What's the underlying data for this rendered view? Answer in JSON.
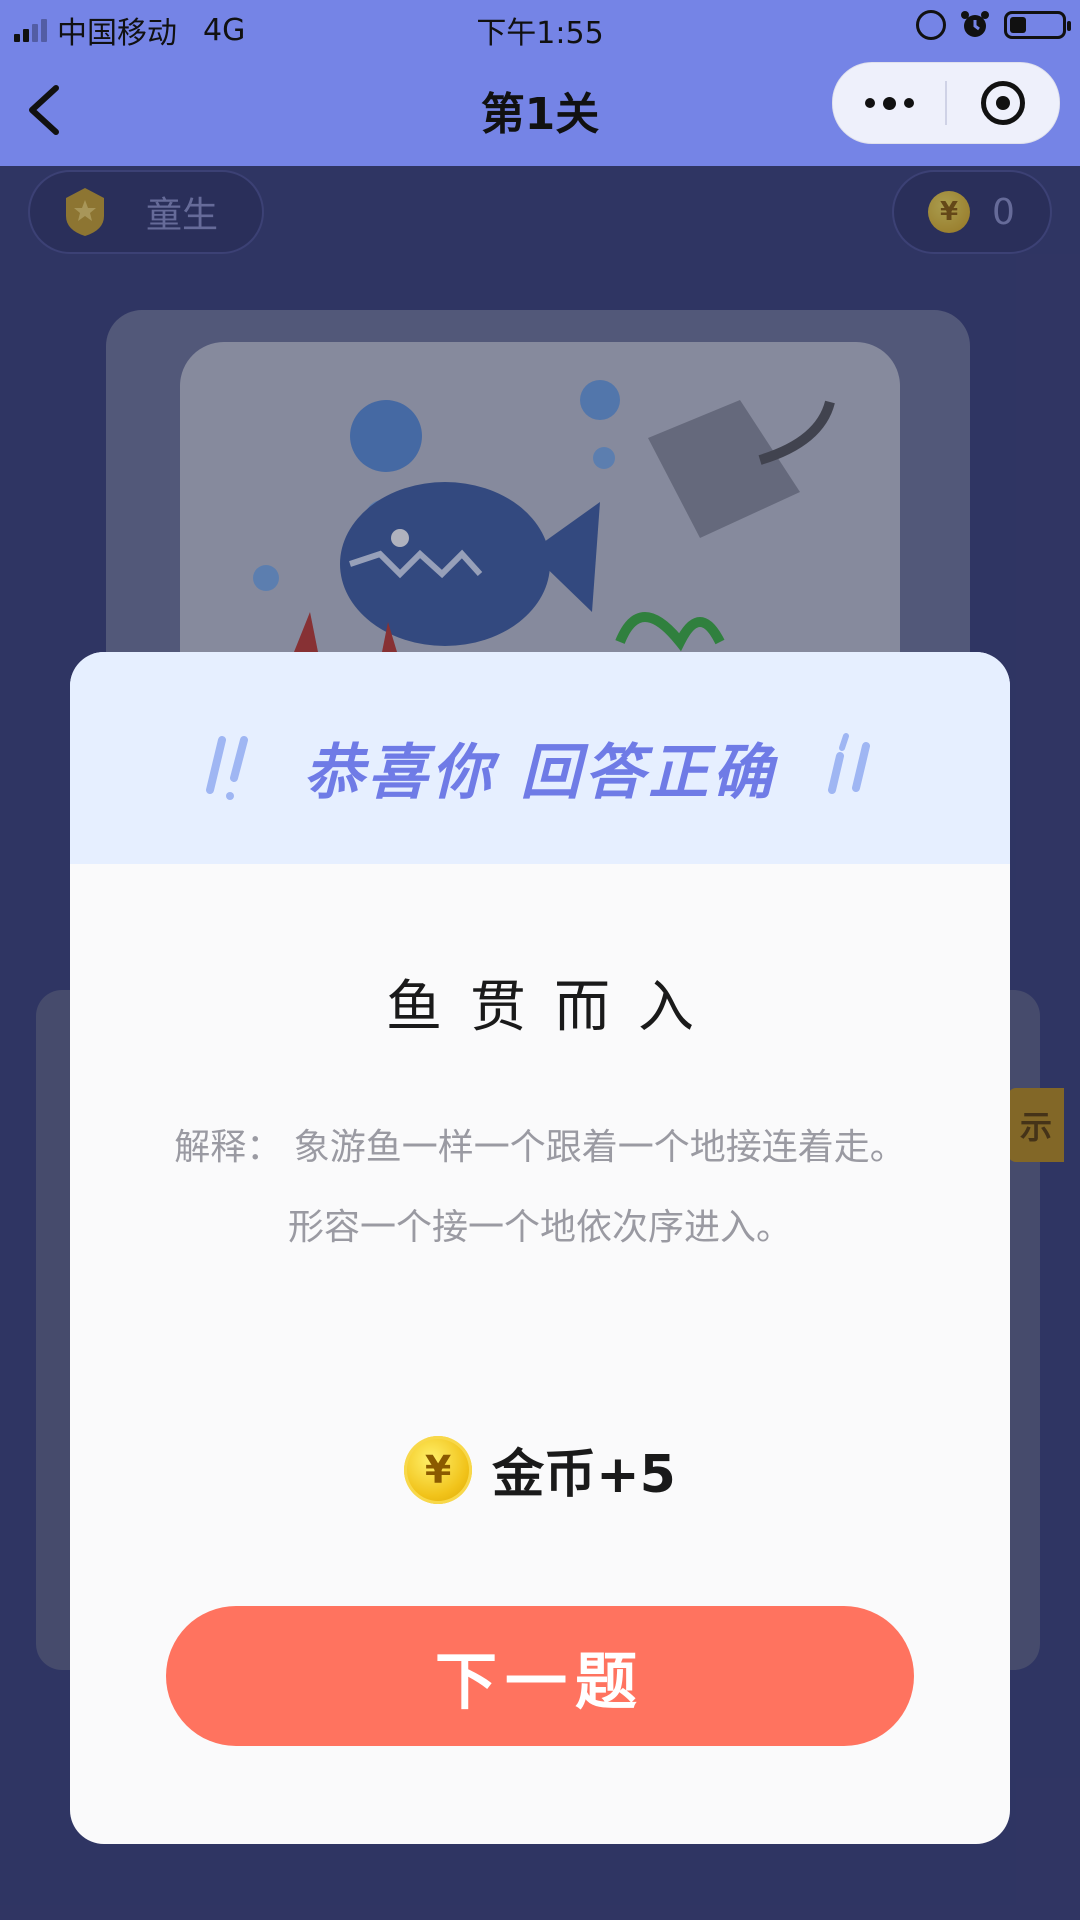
{
  "status_bar": {
    "carrier": "中国移动",
    "network": "4G",
    "time": "下午1:55"
  },
  "nav": {
    "title": "第1关"
  },
  "game": {
    "rank_label": "童生",
    "coin_symbol": "¥",
    "coin_count": "0",
    "hint_tab_text": "示"
  },
  "modal": {
    "banner": "恭喜你 回答正确",
    "idiom": "鱼贯而入",
    "explanation": "解释：  象游鱼一样一个跟着一个地接连着走。形容一个接一个地依次序进入。",
    "coin_symbol": "¥",
    "reward": "金币+5",
    "next_button": "下一题"
  },
  "colors": {
    "nav_background": "#7584e6",
    "page_background": "#3a3f73",
    "banner_text": "#6f7be6",
    "next_button": "#ff735f",
    "coin": "#f1c31a"
  },
  "icons": [
    "signal-icon",
    "lock-rotation-icon",
    "alarm-icon",
    "battery-icon",
    "back-arrow-icon",
    "more-icon",
    "close-target-icon",
    "rank-badge-icon",
    "coin-icon",
    "fish-illustration"
  ]
}
